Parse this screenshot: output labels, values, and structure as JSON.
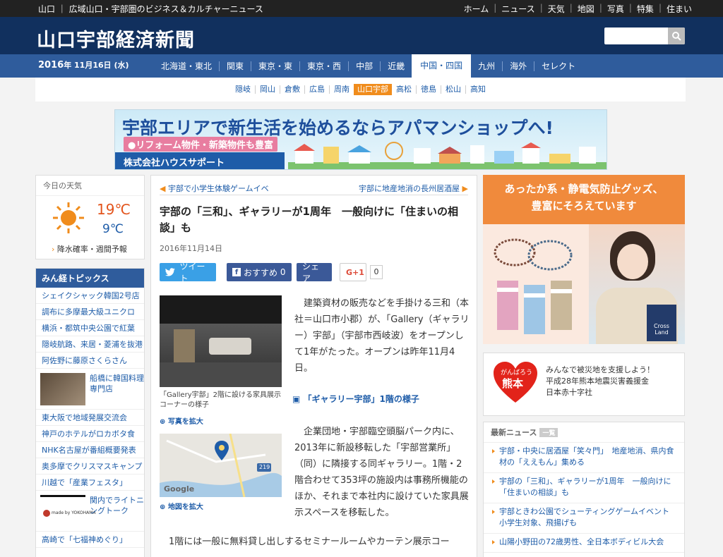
{
  "topbar": {
    "tagline": "山口 ｜ 広域山口・宇部圏のビジネス＆カルチャーニュース",
    "nav": [
      "ホーム",
      "ニュース",
      "天気",
      "地図",
      "写真",
      "特集",
      "住まい"
    ]
  },
  "header": {
    "logo": "山口宇部経済新聞",
    "search_placeholder": ""
  },
  "regionbar": {
    "date_year": "2016",
    "date_rest": "年 11月16日 (水)",
    "regions": [
      "北海道・東北",
      "関東",
      "東京・東",
      "東京・西",
      "中部",
      "近畿",
      "中国・四国",
      "九州",
      "海外",
      "セレクト"
    ],
    "active_region": "中国・四国"
  },
  "cities": {
    "items": [
      "隠岐",
      "岡山",
      "倉敷",
      "広島",
      "周南",
      "山口宇部",
      "高松",
      "徳島",
      "松山",
      "高知"
    ],
    "active": "山口宇部"
  },
  "banner": {
    "line1": "宇部エリアで新生活を始めるならアパマンショップへ!",
    "line2": "●リフォーム物件・新築物件も豊富",
    "line3": "株式会社ハウスサポート"
  },
  "weather": {
    "heading": "今日の天気",
    "high": "19℃",
    "low": "9℃",
    "link": "降水確率・週間予報"
  },
  "topics": {
    "heading": "みん経トピックス",
    "items": [
      "シェイクシャック韓国2号店",
      "調布に多摩最大級ユニクロ",
      "横浜・都筑中央公園で紅葉",
      "隠岐航路、来居・菱浦を抜港",
      "阿佐野に藤原さくらさん"
    ],
    "pic1": "船橋に韓国料理専門店",
    "items2": [
      "東大阪で地域発展交流会",
      "神戸のホテルがロカボタ食",
      "NHK名古屋が番組概要発表",
      "奥多摩でクリスマスキャンプ",
      "川越で「産業フェスタ」"
    ],
    "pic2": "関内でライトニングトーク",
    "pic2_logo": "made by YOKOHAMA",
    "last": "高崎で「七福神めぐり」"
  },
  "article": {
    "prev": "宇部で小学生体験ゲームイベ",
    "next": "宇部に地産地消の長州居酒屋",
    "title": "宇部の「三和」、ギャラリーが1周年　一般向けに「住まいの相談」も",
    "date": "2016年11月14日",
    "share": {
      "tweet": "ツイート",
      "fb": "おすすめ",
      "fb_count": "0",
      "fb_share": "シェア",
      "gplus": "G+1",
      "gplus_count": "0"
    },
    "photo_caption": "「Gallery宇部」2階に設ける家具展示コーナーの様子",
    "photo_zoom": "写真を拡大",
    "map_zoom": "地図を拡大",
    "map_label": "Google",
    "map_road": "219",
    "body1": "建築資材の販売などを手掛ける三和（本社＝山口市小郡）が、「Gallery（ギャラリー）宇部」（宇部市西岐波）をオープンして1年がたった。オープンは昨年11月4日。",
    "photo_heading": "「ギャラリー宇部」1階の様子",
    "body2": "企業団地・宇部臨空頭脳パーク内に、2013年に新設移転した「宇部営業所」（同）に隣接する同ギャラリー。1階・2階合わせて353坪の施設内は事務所機能のほか、それまで本社内に設けていた家具展示スペースを移転した。",
    "body3": "1階には一般に無料貸し出しするセミナールームやカーテン展示コー"
  },
  "ad": {
    "headline1": "あったか系・静電気防止グッズ、",
    "headline2": "豊富にそろえています",
    "logo": "Cross Land"
  },
  "kumamoto": {
    "heart1": "がんばろう",
    "heart2": "熊本",
    "line1": "みんなで被災地を支援しよう！",
    "line2": "平成28年熊本地震災害義援金",
    "line3": "日本赤十字社"
  },
  "news": {
    "heading": "最新ニュース",
    "badge": "一覧",
    "items": [
      "宇部・中央に居酒屋「笑々門」　地産地消、県内食材の「ええもん」集める",
      "宇部の「三和」、ギャラリーが1周年　一般向けに「住まいの相談」も",
      "宇部ときわ公園でシューティングゲームイベント　小学生対象、飛揚げも",
      "山陽小野田の72歳男性、全日本ボディビル大会"
    ]
  }
}
